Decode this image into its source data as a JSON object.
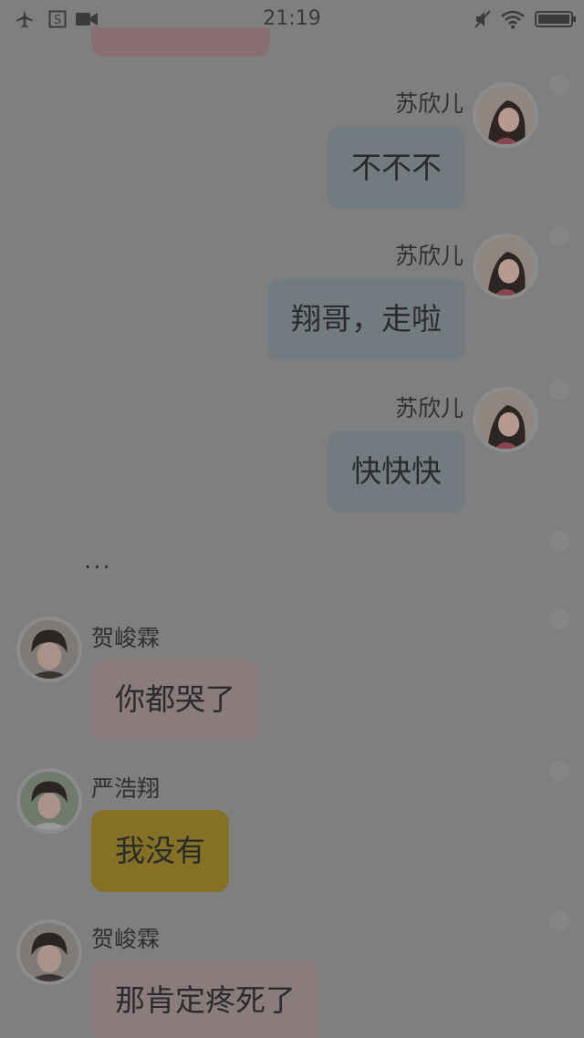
{
  "status_bar": {
    "time": "21:19",
    "left_icons": [
      "airplane-icon",
      "s-app-icon",
      "video-icon"
    ],
    "right_icons": [
      "mute-icon",
      "wifi-icon",
      "battery-icon"
    ]
  },
  "colors": {
    "background": "#7f7f7f",
    "right_bubble": "#727b80",
    "pink_bubble": "#8a7b7c",
    "yellow_bubble": "#847126"
  },
  "messages": [
    {
      "sender": "苏欣儿",
      "text": "不不不",
      "side": "right"
    },
    {
      "sender": "苏欣儿",
      "text": "翔哥，走啦",
      "side": "right"
    },
    {
      "sender": "苏欣儿",
      "text": "快快快",
      "side": "right"
    },
    {
      "text": "...",
      "type": "narration"
    },
    {
      "sender": "贺峻霖",
      "text": "你都哭了",
      "side": "left"
    },
    {
      "sender": "严浩翔",
      "text": "我没有",
      "side": "left"
    },
    {
      "sender": "贺峻霖",
      "text": "那肯定疼死了",
      "side": "left"
    }
  ]
}
